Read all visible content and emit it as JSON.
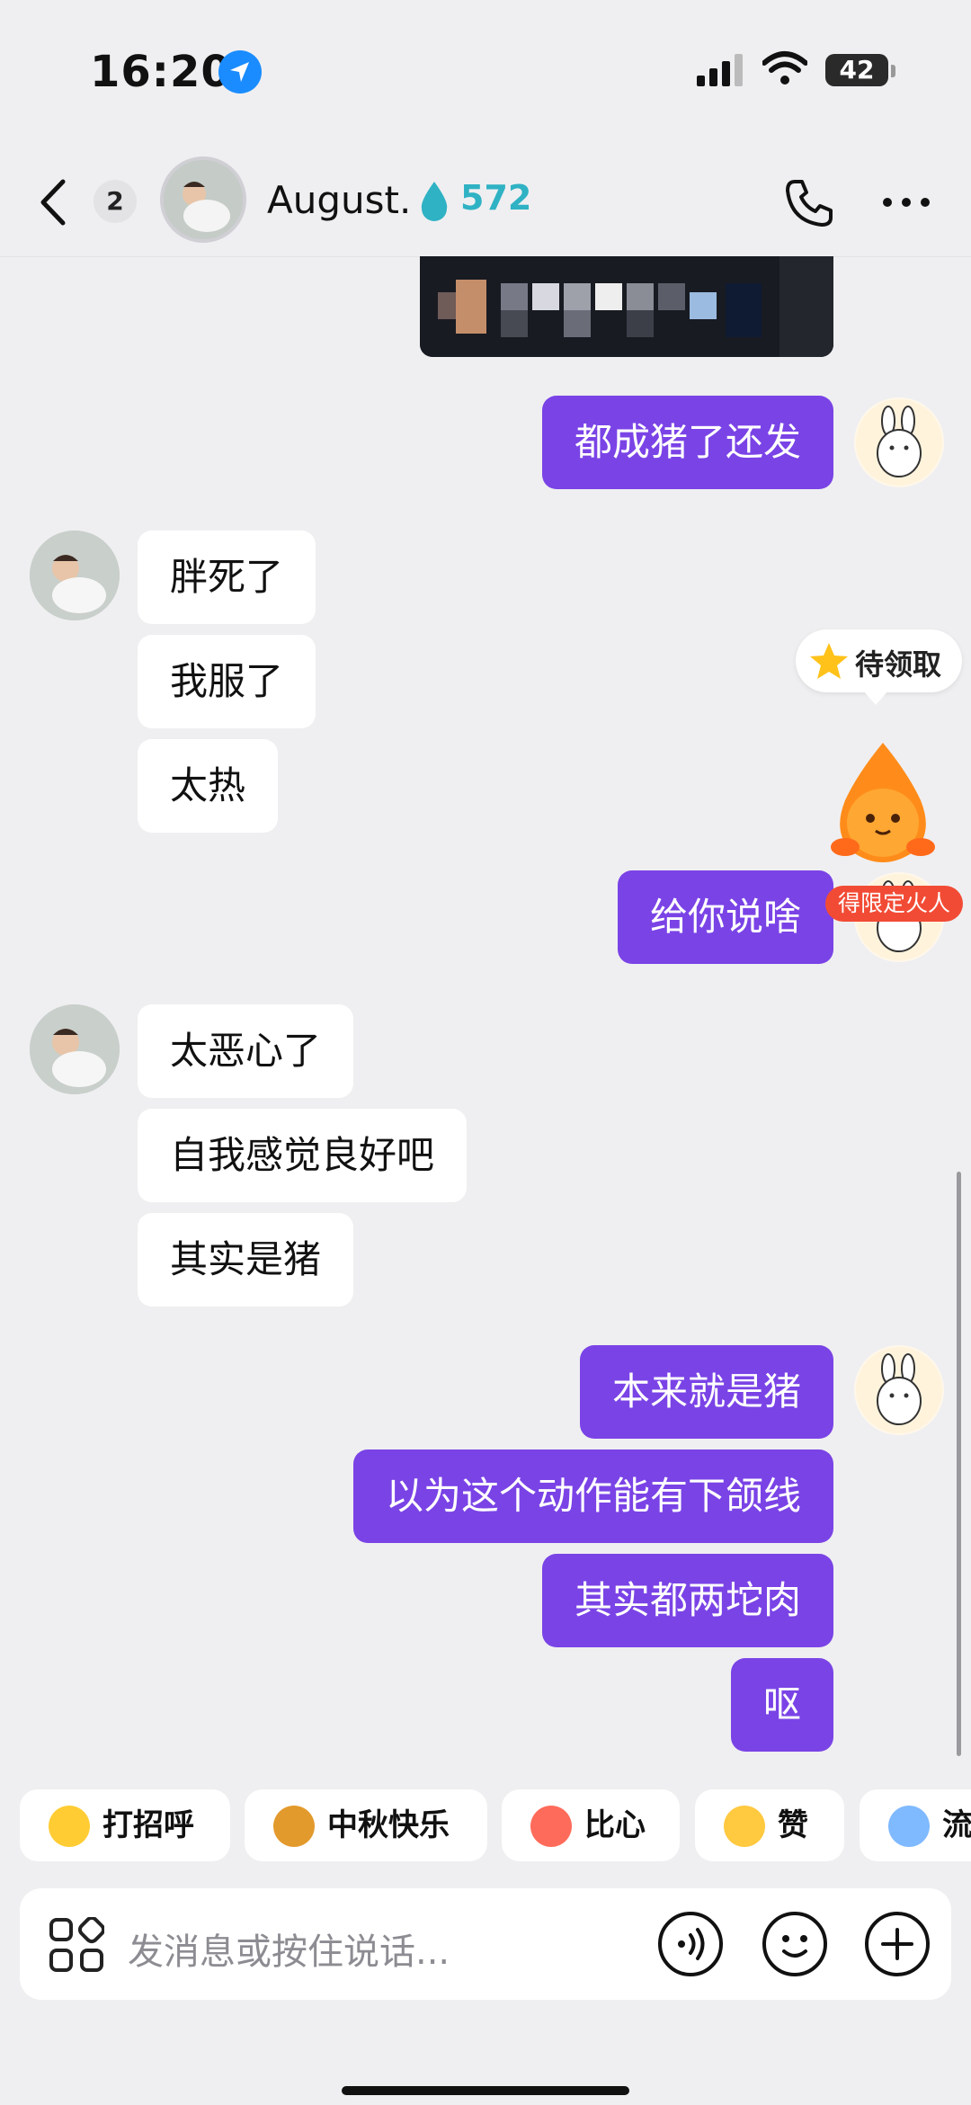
{
  "status_bar": {
    "time": "16:20",
    "battery": "42",
    "icons": [
      "location-arrow-icon",
      "cellular-signal-icon",
      "wifi-icon",
      "battery-icon"
    ]
  },
  "header": {
    "unread_count": "2",
    "contact_name": "August.",
    "spark_count": "572",
    "icons": [
      "back-chevron-icon",
      "water-drop-icon",
      "phone-icon",
      "more-icon"
    ]
  },
  "messages": [
    {
      "side": "right",
      "text": "都成猪了还发"
    },
    {
      "side": "left",
      "text": "胖死了"
    },
    {
      "side": "left",
      "text": "我服了"
    },
    {
      "side": "left",
      "text": "太热"
    },
    {
      "side": "right",
      "text": "给你说啥"
    },
    {
      "side": "left",
      "text": "太恶心了"
    },
    {
      "side": "left",
      "text": "自我感觉良好吧"
    },
    {
      "side": "left",
      "text": "其实是猪"
    },
    {
      "side": "right",
      "text": "本来就是猪"
    },
    {
      "side": "right",
      "text": "以为这个动作能有下颌线"
    },
    {
      "side": "right",
      "text": "其实都两坨肉"
    },
    {
      "side": "right",
      "text": "呕"
    }
  ],
  "reward": {
    "pending_label": "待领取",
    "mascot_label": "得限定火人"
  },
  "quick_replies": [
    {
      "label": "打招呼",
      "icon": "wave-emoji-icon"
    },
    {
      "label": "中秋快乐",
      "icon": "mooncake-icon"
    },
    {
      "label": "比心",
      "icon": "heart-hands-icon"
    },
    {
      "label": "赞",
      "icon": "thumbs-up-icon"
    },
    {
      "label": "流",
      "icon": "crying-emoji-icon"
    }
  ],
  "input": {
    "placeholder": "发消息或按住说话..."
  },
  "colors": {
    "outgoing_bubble": "#7a43e6",
    "incoming_bubble": "#ffffff",
    "background": "#efeff1",
    "spark_text": "#2fb2c4"
  }
}
